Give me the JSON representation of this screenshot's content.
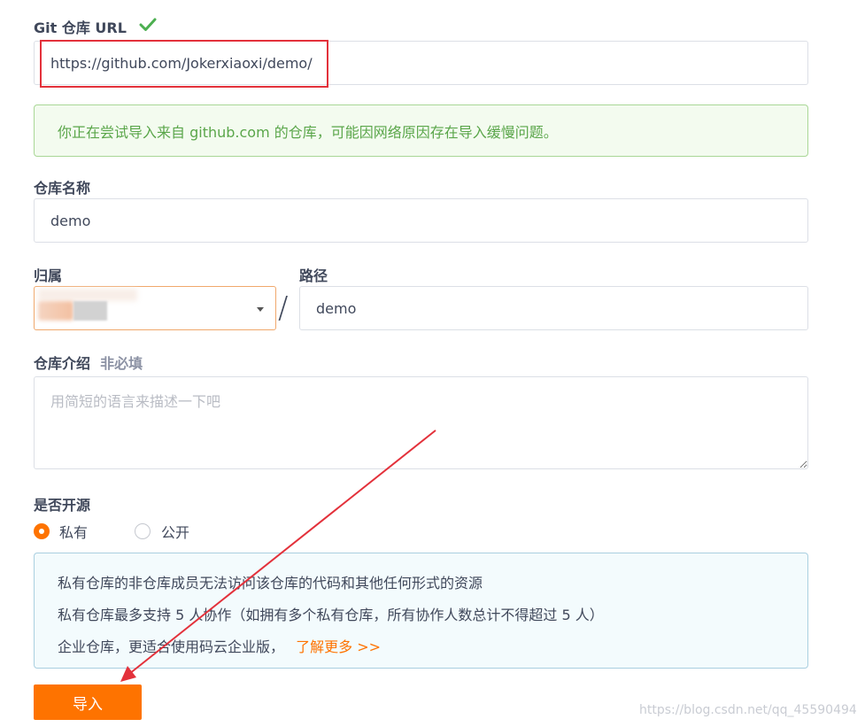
{
  "git_url": {
    "label": "Git 仓库 URL",
    "value": "https://github.com/Jokerxiaoxi/demo/",
    "status_icon": "check-icon",
    "status_color": "#4caf50"
  },
  "import_notice": "你正在尝试导入来自 github.com 的仓库，可能因网络原因存在导入缓慢问题。",
  "repo_name": {
    "label": "仓库名称",
    "value": "demo"
  },
  "owner": {
    "label": "归属",
    "separator": "/"
  },
  "path": {
    "label": "路径",
    "value": "demo"
  },
  "description": {
    "label": "仓库介绍",
    "optional_tag": "非必填",
    "placeholder": "用简短的语言来描述一下吧"
  },
  "visibility": {
    "label": "是否开源",
    "options": [
      {
        "label": "私有",
        "selected": true
      },
      {
        "label": "公开",
        "selected": false
      }
    ]
  },
  "private_notice": {
    "line1": "私有仓库的非仓库成员无法访问该仓库的代码和其他任何形式的资源",
    "line2": "私有仓库最多支持 5 人协作（如拥有多个私有仓库，所有协作人数总计不得超过 5 人）",
    "line3": "企业仓库，更适合使用码云企业版，",
    "link": "了解更多 >>"
  },
  "import_button": "导入",
  "watermark": "https://blog.csdn.net/qq_45590494",
  "colors": {
    "accent": "#fe7300",
    "annotation_red": "#e3313b",
    "success_green": "#5aa64a"
  }
}
